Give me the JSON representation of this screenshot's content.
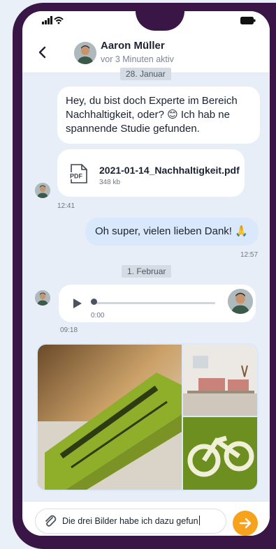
{
  "header": {
    "contact_name": "Aaron Müller",
    "contact_status": "vor 3 Minuten aktiv"
  },
  "messages": {
    "date1": "28. Januar",
    "msg1_text": "Hey, du bist doch Experte im Bereich Nachhaltigkeit, oder? 😊 Ich hab ne spannende Studie gefunden.",
    "file_name": "2021-01-14_Nachhaltigkeit.pdf",
    "file_size": "348 kb",
    "file_icon_label": "PDF",
    "time1": "12:41",
    "msg2_text": "Oh super, vielen lieben Dank! 🙏",
    "time2": "12:57",
    "date2": "1. Februar",
    "audio_time": "0:00",
    "time3": "09:18"
  },
  "composer": {
    "input_value": "Die drei Bilder habe ich dazu gefun"
  },
  "colors": {
    "frame": "#3a1646",
    "accent_send": "#f6a21c",
    "outgoing_bubble": "#d9e9fb"
  }
}
